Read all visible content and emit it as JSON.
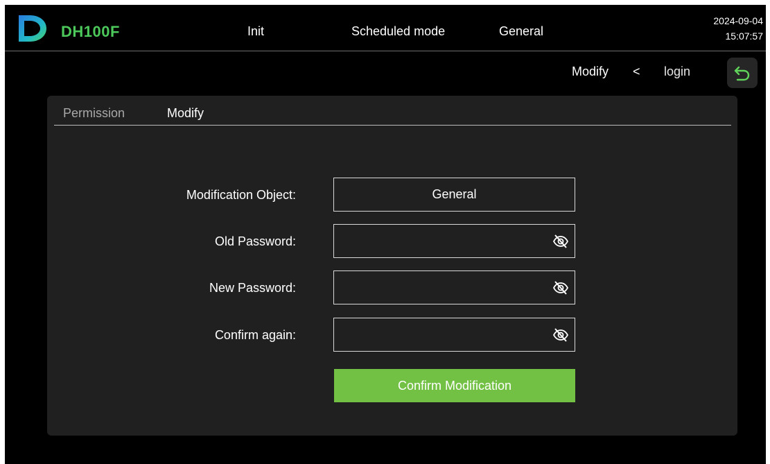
{
  "header": {
    "brand": "DH100F",
    "nav": [
      "Init",
      "Scheduled mode",
      "General"
    ],
    "date": "2024-09-04",
    "time": "15:07:57"
  },
  "breadcrumb": {
    "current": "Modify",
    "separator": "<",
    "parent": "login"
  },
  "tabs": [
    "Permission",
    "Modify"
  ],
  "form": {
    "object_label": "Modification Object:",
    "object_value": "General",
    "old_label": "Old Password:",
    "new_label": "New Password:",
    "confirm_label": "Confirm again:",
    "old_value": "",
    "new_value": "",
    "confirm_value": "",
    "submit_label": "Confirm Modification"
  },
  "colors": {
    "brand": "#4cc95a",
    "accent_button": "#73c144",
    "background": "#000000",
    "panel": "#202020"
  },
  "icons": {
    "logo": "d-logo",
    "back": "back-arrow-icon",
    "password_toggle": "eye-off-icon"
  }
}
